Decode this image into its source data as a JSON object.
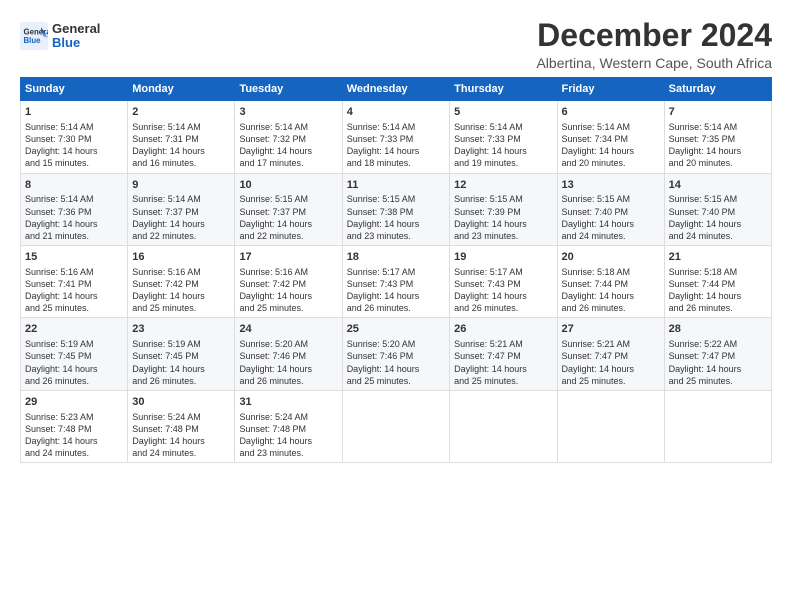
{
  "logo": {
    "line1": "General",
    "line2": "Blue"
  },
  "title": "December 2024",
  "subtitle": "Albertina, Western Cape, South Africa",
  "weekdays": [
    "Sunday",
    "Monday",
    "Tuesday",
    "Wednesday",
    "Thursday",
    "Friday",
    "Saturday"
  ],
  "weeks": [
    [
      {
        "day": "1",
        "sunrise": "5:14 AM",
        "sunset": "7:30 PM",
        "daylight": "14 hours and 15 minutes."
      },
      {
        "day": "2",
        "sunrise": "5:14 AM",
        "sunset": "7:31 PM",
        "daylight": "14 hours and 16 minutes."
      },
      {
        "day": "3",
        "sunrise": "5:14 AM",
        "sunset": "7:32 PM",
        "daylight": "14 hours and 17 minutes."
      },
      {
        "day": "4",
        "sunrise": "5:14 AM",
        "sunset": "7:33 PM",
        "daylight": "14 hours and 18 minutes."
      },
      {
        "day": "5",
        "sunrise": "5:14 AM",
        "sunset": "7:33 PM",
        "daylight": "14 hours and 19 minutes."
      },
      {
        "day": "6",
        "sunrise": "5:14 AM",
        "sunset": "7:34 PM",
        "daylight": "14 hours and 20 minutes."
      },
      {
        "day": "7",
        "sunrise": "5:14 AM",
        "sunset": "7:35 PM",
        "daylight": "14 hours and 20 minutes."
      }
    ],
    [
      {
        "day": "8",
        "sunrise": "5:14 AM",
        "sunset": "7:36 PM",
        "daylight": "14 hours and 21 minutes."
      },
      {
        "day": "9",
        "sunrise": "5:14 AM",
        "sunset": "7:37 PM",
        "daylight": "14 hours and 22 minutes."
      },
      {
        "day": "10",
        "sunrise": "5:15 AM",
        "sunset": "7:37 PM",
        "daylight": "14 hours and 22 minutes."
      },
      {
        "day": "11",
        "sunrise": "5:15 AM",
        "sunset": "7:38 PM",
        "daylight": "14 hours and 23 minutes."
      },
      {
        "day": "12",
        "sunrise": "5:15 AM",
        "sunset": "7:39 PM",
        "daylight": "14 hours and 23 minutes."
      },
      {
        "day": "13",
        "sunrise": "5:15 AM",
        "sunset": "7:40 PM",
        "daylight": "14 hours and 24 minutes."
      },
      {
        "day": "14",
        "sunrise": "5:15 AM",
        "sunset": "7:40 PM",
        "daylight": "14 hours and 24 minutes."
      }
    ],
    [
      {
        "day": "15",
        "sunrise": "5:16 AM",
        "sunset": "7:41 PM",
        "daylight": "14 hours and 25 minutes."
      },
      {
        "day": "16",
        "sunrise": "5:16 AM",
        "sunset": "7:42 PM",
        "daylight": "14 hours and 25 minutes."
      },
      {
        "day": "17",
        "sunrise": "5:16 AM",
        "sunset": "7:42 PM",
        "daylight": "14 hours and 25 minutes."
      },
      {
        "day": "18",
        "sunrise": "5:17 AM",
        "sunset": "7:43 PM",
        "daylight": "14 hours and 26 minutes."
      },
      {
        "day": "19",
        "sunrise": "5:17 AM",
        "sunset": "7:43 PM",
        "daylight": "14 hours and 26 minutes."
      },
      {
        "day": "20",
        "sunrise": "5:18 AM",
        "sunset": "7:44 PM",
        "daylight": "14 hours and 26 minutes."
      },
      {
        "day": "21",
        "sunrise": "5:18 AM",
        "sunset": "7:44 PM",
        "daylight": "14 hours and 26 minutes."
      }
    ],
    [
      {
        "day": "22",
        "sunrise": "5:19 AM",
        "sunset": "7:45 PM",
        "daylight": "14 hours and 26 minutes."
      },
      {
        "day": "23",
        "sunrise": "5:19 AM",
        "sunset": "7:45 PM",
        "daylight": "14 hours and 26 minutes."
      },
      {
        "day": "24",
        "sunrise": "5:20 AM",
        "sunset": "7:46 PM",
        "daylight": "14 hours and 26 minutes."
      },
      {
        "day": "25",
        "sunrise": "5:20 AM",
        "sunset": "7:46 PM",
        "daylight": "14 hours and 25 minutes."
      },
      {
        "day": "26",
        "sunrise": "5:21 AM",
        "sunset": "7:47 PM",
        "daylight": "14 hours and 25 minutes."
      },
      {
        "day": "27",
        "sunrise": "5:21 AM",
        "sunset": "7:47 PM",
        "daylight": "14 hours and 25 minutes."
      },
      {
        "day": "28",
        "sunrise": "5:22 AM",
        "sunset": "7:47 PM",
        "daylight": "14 hours and 25 minutes."
      }
    ],
    [
      {
        "day": "29",
        "sunrise": "5:23 AM",
        "sunset": "7:48 PM",
        "daylight": "14 hours and 24 minutes."
      },
      {
        "day": "30",
        "sunrise": "5:24 AM",
        "sunset": "7:48 PM",
        "daylight": "14 hours and 24 minutes."
      },
      {
        "day": "31",
        "sunrise": "5:24 AM",
        "sunset": "7:48 PM",
        "daylight": "14 hours and 23 minutes."
      },
      null,
      null,
      null,
      null
    ]
  ],
  "labels": {
    "sunrise": "Sunrise:",
    "sunset": "Sunset:",
    "daylight": "Daylight:"
  }
}
